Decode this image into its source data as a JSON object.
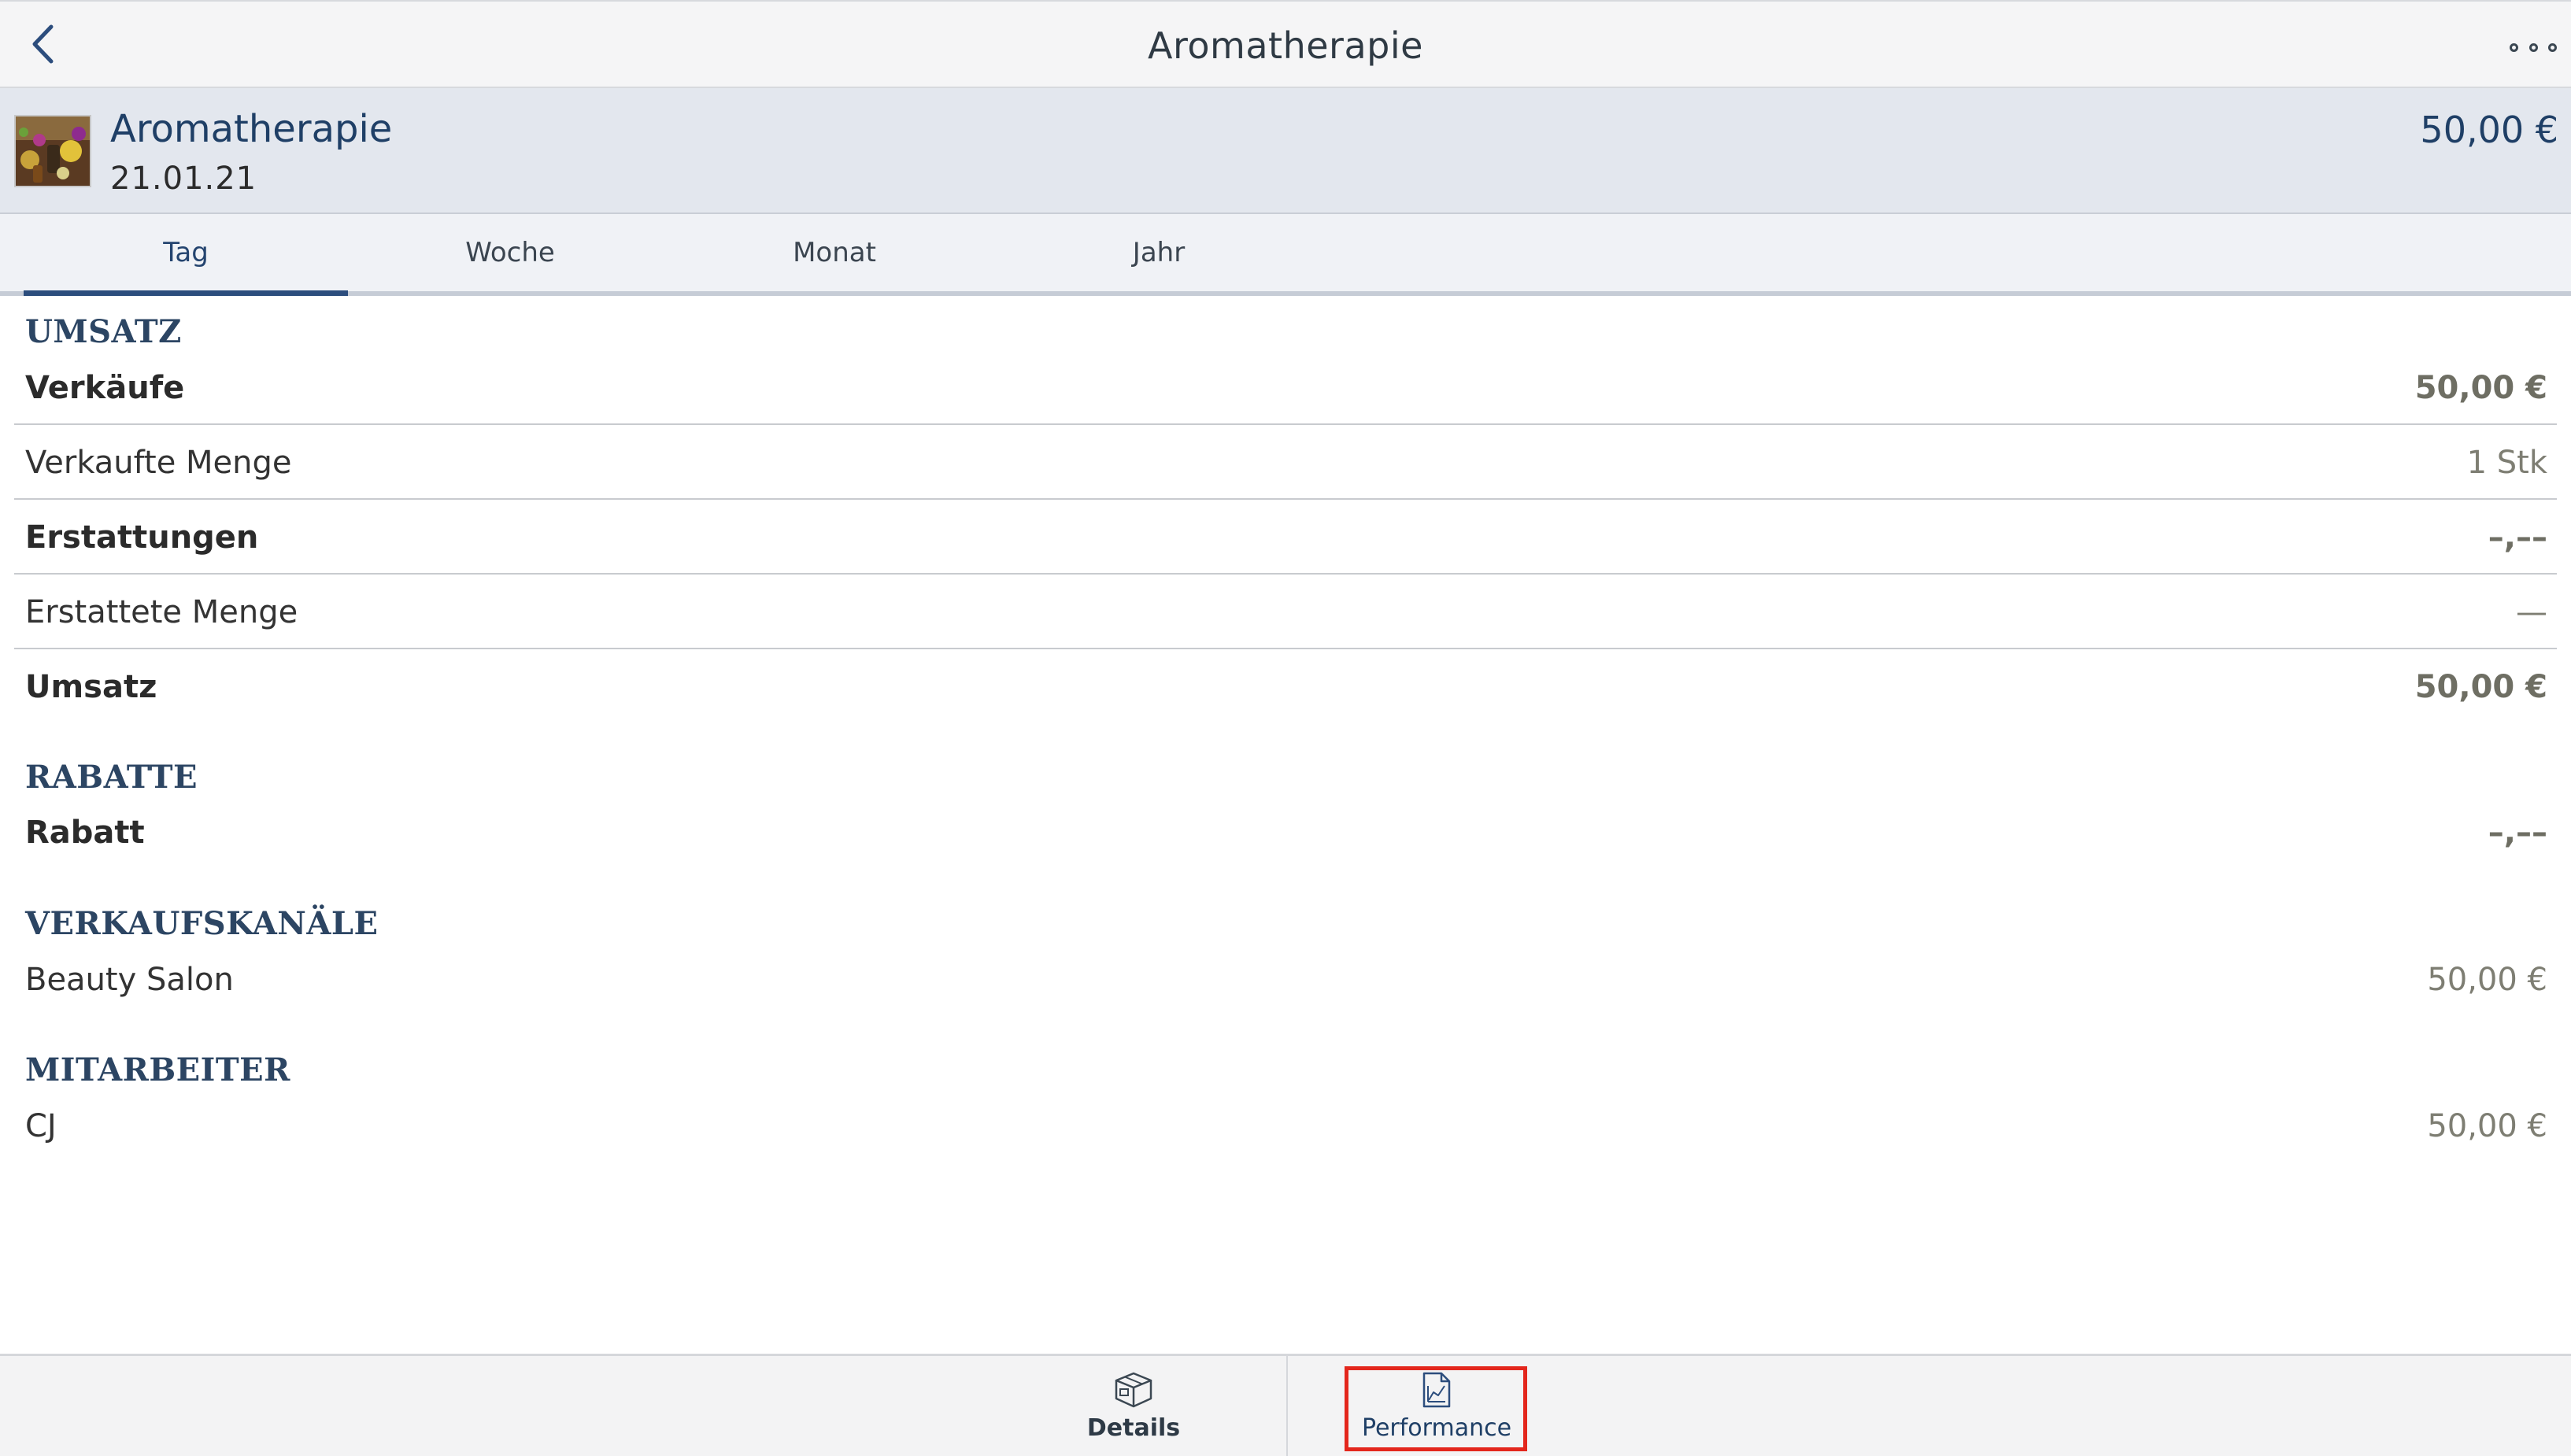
{
  "nav": {
    "title": "Aromatherapie",
    "back_icon": "chevron-left-icon",
    "more_icon": "more-icon"
  },
  "product": {
    "name": "Aromatherapie",
    "date": "21.01.21",
    "price": "50,00 €",
    "thumbnail_icon": "product-thumbnail"
  },
  "tabs": [
    {
      "label": "Tag",
      "active": true
    },
    {
      "label": "Woche",
      "active": false
    },
    {
      "label": "Monat",
      "active": false
    },
    {
      "label": "Jahr",
      "active": false
    }
  ],
  "sections": {
    "umsatz": {
      "title": "UMSATZ",
      "rows": [
        {
          "label": "Verkäufe",
          "value": "50,00 €"
        },
        {
          "label": "Verkaufte Menge",
          "value": "1 Stk"
        },
        {
          "label": "Erstattungen",
          "value": "–,––"
        },
        {
          "label": "Erstattete Menge",
          "value": "—"
        },
        {
          "label": "Umsatz",
          "value": "50,00 €"
        }
      ]
    },
    "rabatte": {
      "title": "RABATTE",
      "rows": [
        {
          "label": "Rabatt",
          "value": "–,––"
        }
      ]
    },
    "kanaele": {
      "title": "VERKAUFSKANÄLE",
      "rows": [
        {
          "label": "Beauty Salon",
          "value": "50,00 €"
        }
      ]
    },
    "mitarbeiter": {
      "title": "MITARBEITER",
      "rows": [
        {
          "label": "CJ",
          "value": "50,00 €"
        }
      ]
    }
  },
  "bottom_tabs": {
    "details": {
      "label": "Details",
      "icon": "box-icon"
    },
    "performance": {
      "label": "Performance",
      "icon": "chart-document-icon",
      "selected": true
    }
  },
  "colors": {
    "accent": "#2c4d7d",
    "header_bg": "#e3e7ee",
    "highlight": "#e3261c"
  }
}
